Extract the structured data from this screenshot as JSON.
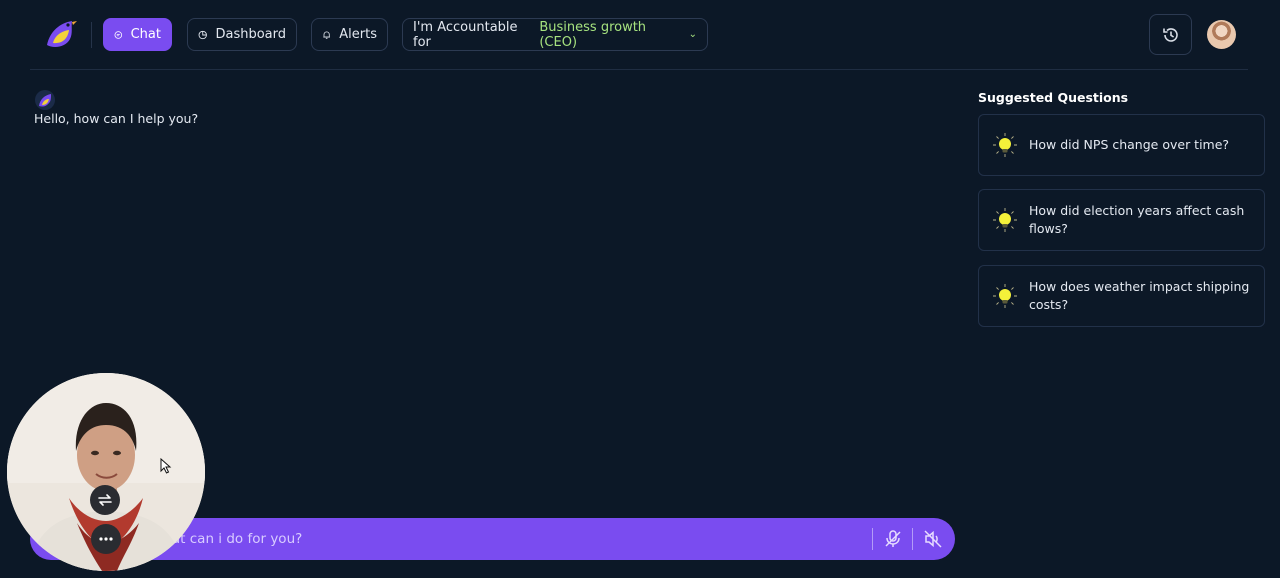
{
  "nav": {
    "chat_label": "Chat",
    "dashboard_label": "Dashboard",
    "alerts_label": "Alerts",
    "accountable_prefix": "I'm Accountable for",
    "accountable_value": "Business growth (CEO)",
    "accountable_chevron": "⌄"
  },
  "icons": {
    "logo": "bird-logo-icon",
    "chat": "chat-bubble-icon",
    "dashboard": "pie-chart-icon",
    "alerts": "bell-icon",
    "history": "history-icon",
    "suggestion": "lightbulb-icon",
    "mic": "mic-off-icon",
    "speaker": "speaker-mute-icon",
    "switch": "switch-camera-icon",
    "more": "more-dots-icon"
  },
  "chat": {
    "bot_message": "Hello, how can I help you?"
  },
  "suggestions": {
    "title": "Suggested Questions",
    "items": [
      {
        "text": "How did NPS change over time?"
      },
      {
        "text": "How did election years affect cash flows?"
      },
      {
        "text": "How does weather impact shipping costs?"
      }
    ]
  },
  "input": {
    "placeholder": "What can i do for you?"
  },
  "colors": {
    "background": "#0c1827",
    "accent": "#7a4cf0",
    "highlight": "#a6e27f",
    "border": "#2c3a52"
  }
}
